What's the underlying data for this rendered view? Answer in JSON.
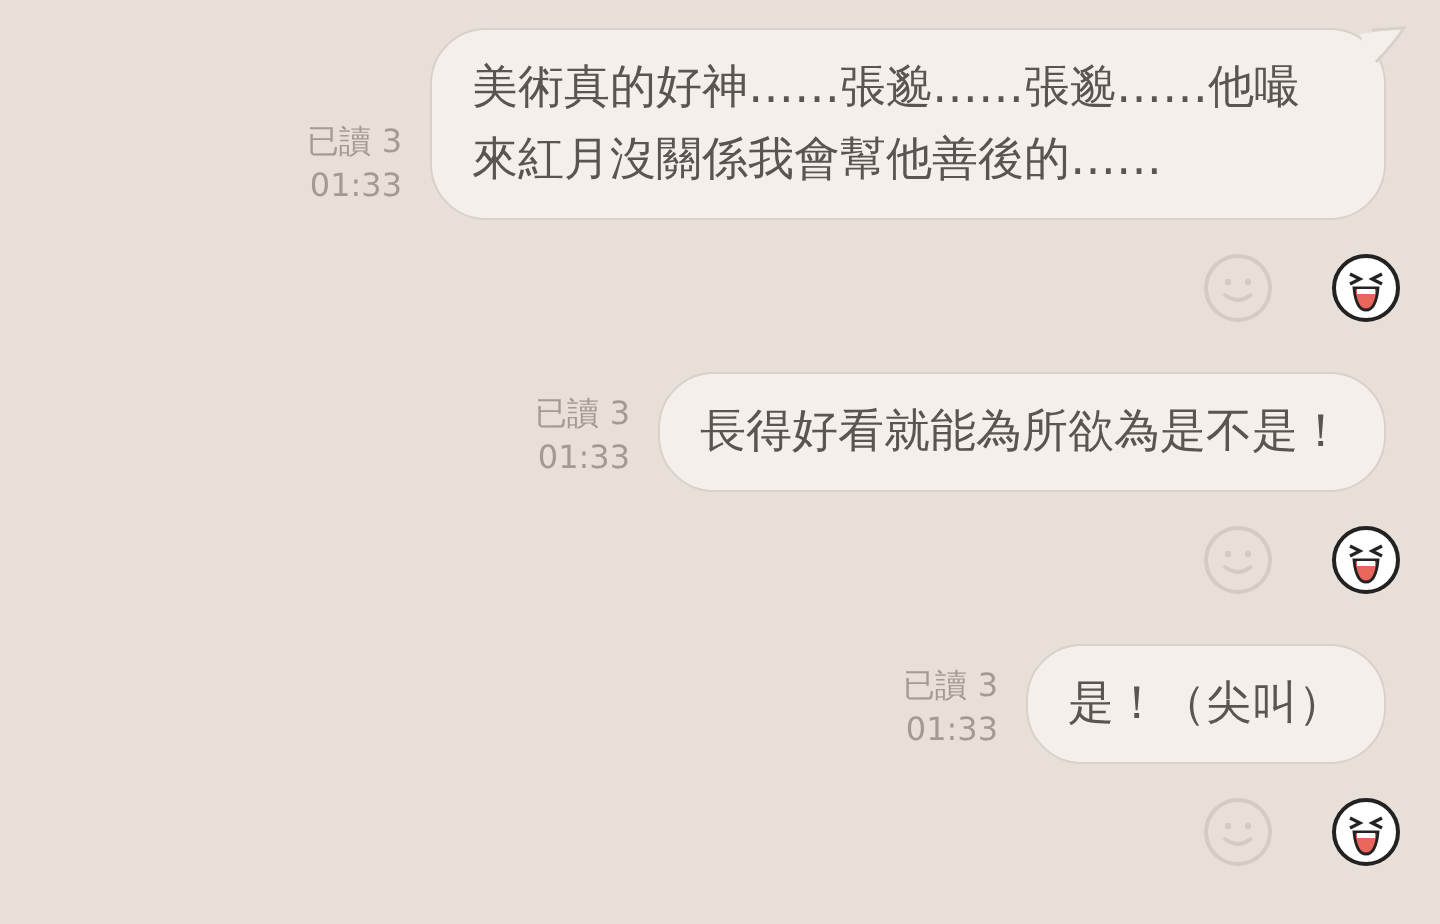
{
  "messages": [
    {
      "read_status": "已讀 3",
      "time": "01:33",
      "text": "美術真的好神……張邈……張邈……他嘬來紅月沒關係我會幫他善後的……",
      "tail": true
    },
    {
      "read_status": "已讀 3",
      "time": "01:33",
      "text": "長得好看就能為所欲為是不是！",
      "tail": false
    },
    {
      "read_status": "已讀 3",
      "time": "01:33",
      "text": "是！（尖叫）",
      "tail": false
    }
  ]
}
